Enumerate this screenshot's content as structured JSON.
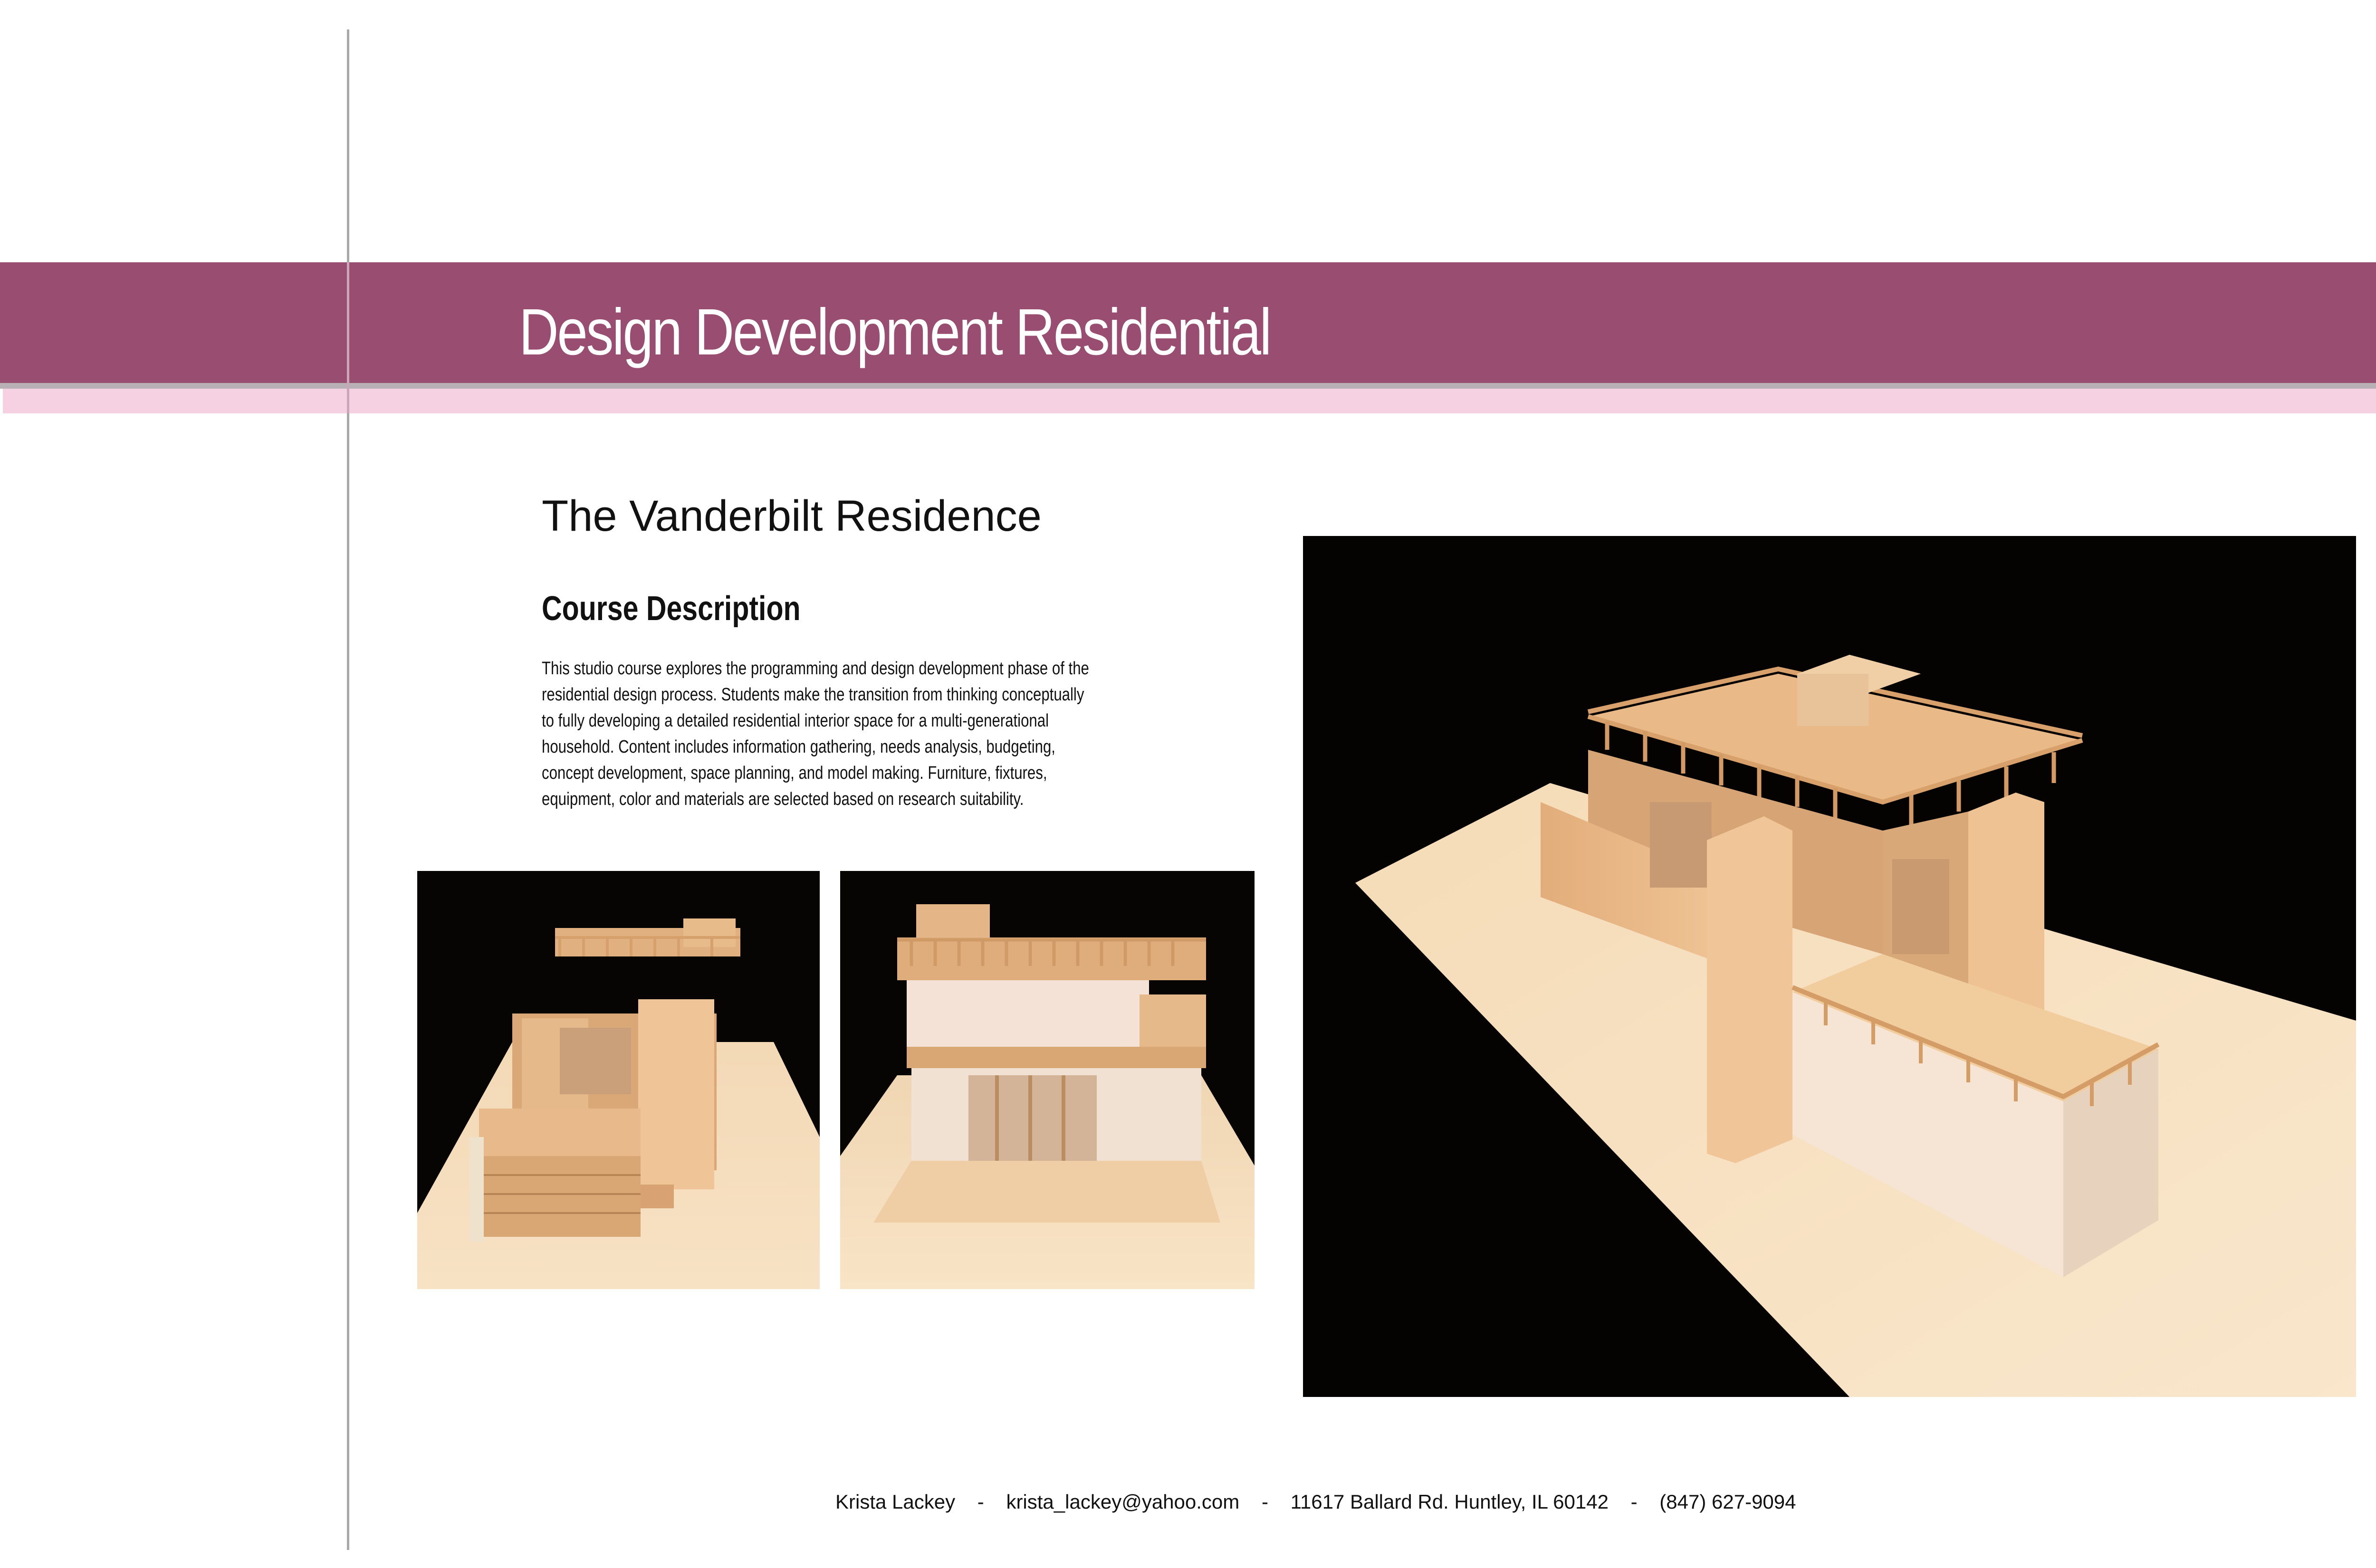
{
  "header": {
    "title": "Design Development Residential"
  },
  "project": {
    "name": "The Vanderbilt Residence",
    "section_heading": "Course Description",
    "description": "This studio course explores the programming and design development phase of the residential design process. Students make the transition from thinking conceptually to fully developing a detailed residential interior space for a multi-generational household. Content includes information gathering, needs analysis, budgeting, concept development, space planning, and model making. Furniture, fixtures, equipment, color and materials are selected based on research suitability."
  },
  "footer": {
    "contact_line": "Krista Lackey    -    krista_lackey@yahoo.com    -    11617 Ballard Rd. Huntley, IL 60142    -    (847) 627-9094"
  },
  "colors": {
    "band": "#984d71",
    "band_accent": "#f6d1e2",
    "divider": "#a8a8a8"
  }
}
